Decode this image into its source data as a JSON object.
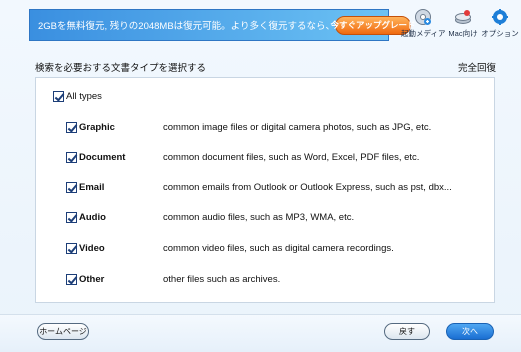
{
  "banner": {
    "text": "2GBを無料復元, 残りの2048MBは復元可能。より多く復元するなら、",
    "upgrade_button": "今すぐアップグレード"
  },
  "toolbar": {
    "boot_media": "起動メディア",
    "mac": "Mac向け",
    "options": "オプション"
  },
  "heading": {
    "select_label": "検索を必要おする文書タイプを選択する",
    "mode_label": "完全回復"
  },
  "file_types": {
    "all_label": "All types",
    "items": [
      {
        "name": "Graphic",
        "description": "common image files or digital camera photos, such as JPG, etc.",
        "checked": true
      },
      {
        "name": "Document",
        "description": "common document files, such as Word, Excel, PDF files, etc.",
        "checked": true
      },
      {
        "name": "Email",
        "description": "common emails from Outlook or Outlook Express, such as pst, dbx...",
        "checked": true
      },
      {
        "name": "Audio",
        "description": "common audio files, such as MP3, WMA, etc.",
        "checked": true
      },
      {
        "name": "Video",
        "description": "common video files, such as digital camera recordings.",
        "checked": true
      },
      {
        "name": "Other",
        "description": "other files such as archives.",
        "checked": true
      }
    ]
  },
  "footer": {
    "home_button": "ホームページ",
    "back_button": "戻す",
    "next_button": "次へ"
  },
  "colors": {
    "banner_start": "#3a8fe0",
    "banner_end": "#6cc2f4",
    "upgrade": "#f06a10",
    "next_button": "#1a6ed2"
  }
}
